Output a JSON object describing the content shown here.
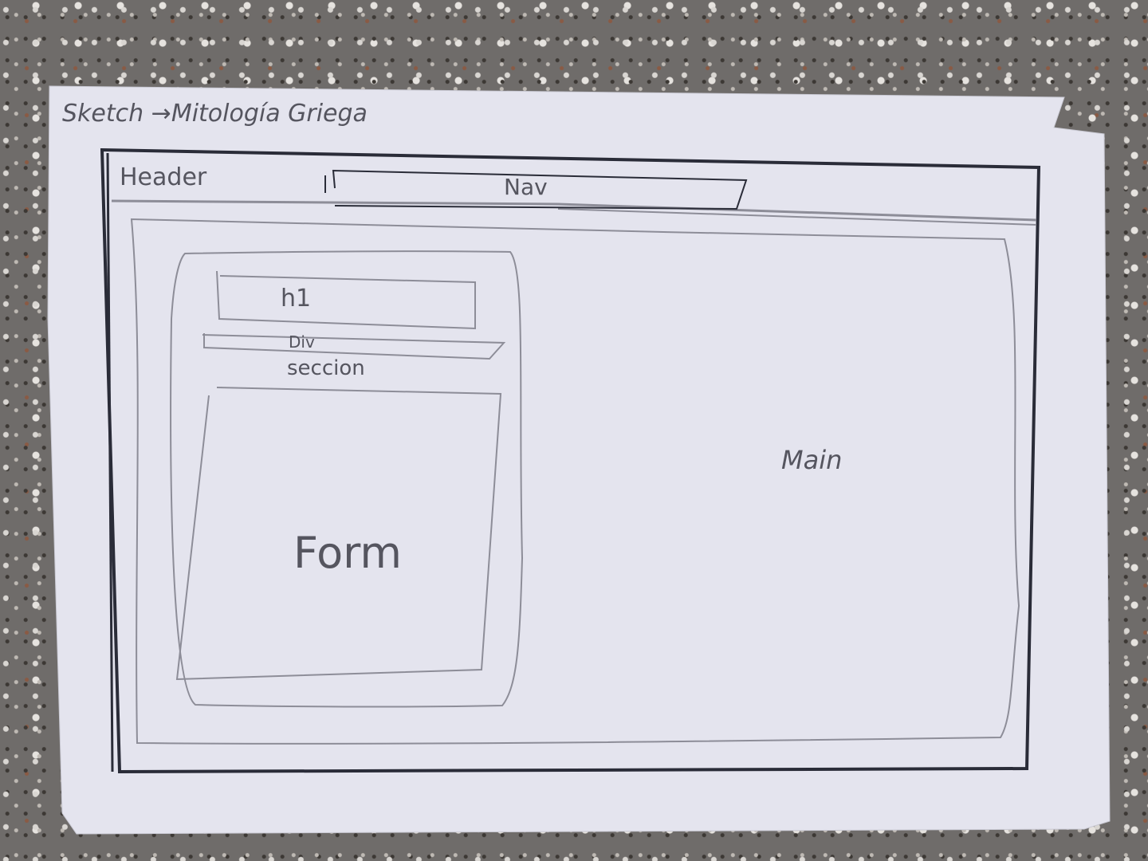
{
  "sketch": {
    "title": "Sketch →Mitología Griega",
    "header_label": "Header",
    "nav_label": "Nav",
    "h1_label": "h1",
    "div_label": "Div",
    "section_label": "seccion",
    "form_label": "Form",
    "main_label": "Main"
  },
  "colors": {
    "paper": "#e4e4ee",
    "pen_ink": "#2a2c38",
    "pencil": "#8d8d98",
    "background": "#6f6c6a"
  }
}
